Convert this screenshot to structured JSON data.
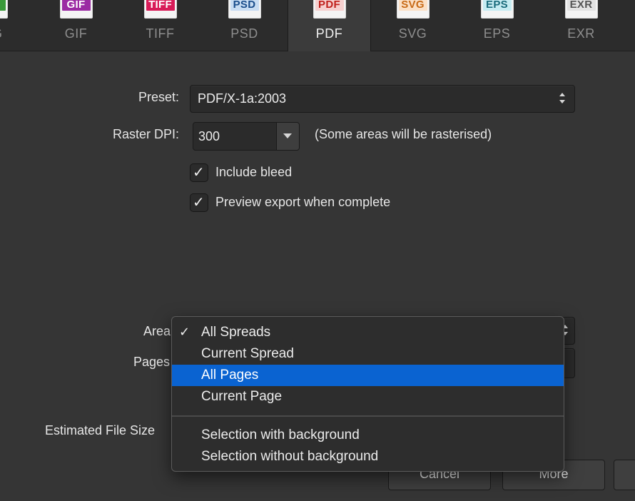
{
  "tabs": [
    {
      "label": "G",
      "badge": "G",
      "badge_color": "#3a9a3a",
      "badge_text_color": "#ffffff",
      "active": false
    },
    {
      "label": "GIF",
      "badge": "GIF",
      "badge_color": "#9b2aa3",
      "badge_text_color": "#ffffff",
      "active": false
    },
    {
      "label": "TIFF",
      "badge": "TIFF",
      "badge_color": "#d81b58",
      "badge_text_color": "#ffffff",
      "active": false
    },
    {
      "label": "PSD",
      "badge": "PSD",
      "badge_color": "#c8dcf2",
      "badge_text_color": "#1b4e8c",
      "active": false
    },
    {
      "label": "PDF",
      "badge": "PDF",
      "badge_color": "#f6d0cf",
      "badge_text_color": "#c0201b",
      "active": true
    },
    {
      "label": "SVG",
      "badge": "SVG",
      "badge_color": "#fbe0c6",
      "badge_text_color": "#c86a16",
      "active": false
    },
    {
      "label": "EPS",
      "badge": "EPS",
      "badge_color": "#c6ecf2",
      "badge_text_color": "#1a6c7c",
      "active": false
    },
    {
      "label": "EXR",
      "badge": "EXR",
      "badge_color": "#e3e3e3",
      "badge_text_color": "#555555",
      "active": false
    }
  ],
  "form": {
    "preset_label": "Preset:",
    "preset_value": "PDF/X-1a:2003",
    "dpi_label": "Raster DPI:",
    "dpi_value": "300",
    "dpi_note": "(Some areas will be rasterised)",
    "include_bleed_label": "Include bleed",
    "include_bleed_checked": true,
    "preview_label": "Preview export when complete",
    "preview_checked": true,
    "area_label": "Area",
    "pages_label": "Pages",
    "file_size_label": "Estimated File Size"
  },
  "buttons": {
    "cancel": "Cancel",
    "more": "More"
  },
  "menu": {
    "checkmark": "✓",
    "items": [
      {
        "label": "All Spreads",
        "checked": true,
        "highlighted": false
      },
      {
        "label": "Current Spread",
        "checked": false,
        "highlighted": false
      },
      {
        "label": "All Pages",
        "checked": false,
        "highlighted": true
      },
      {
        "label": "Current Page",
        "checked": false,
        "highlighted": false
      },
      {
        "label": "Selection with background",
        "checked": false,
        "highlighted": false
      },
      {
        "label": "Selection without background",
        "checked": false,
        "highlighted": false
      }
    ]
  },
  "checkmark_glyph": "✓",
  "colors": {
    "accent_highlight": "#0a63d1",
    "background": "#353535"
  }
}
